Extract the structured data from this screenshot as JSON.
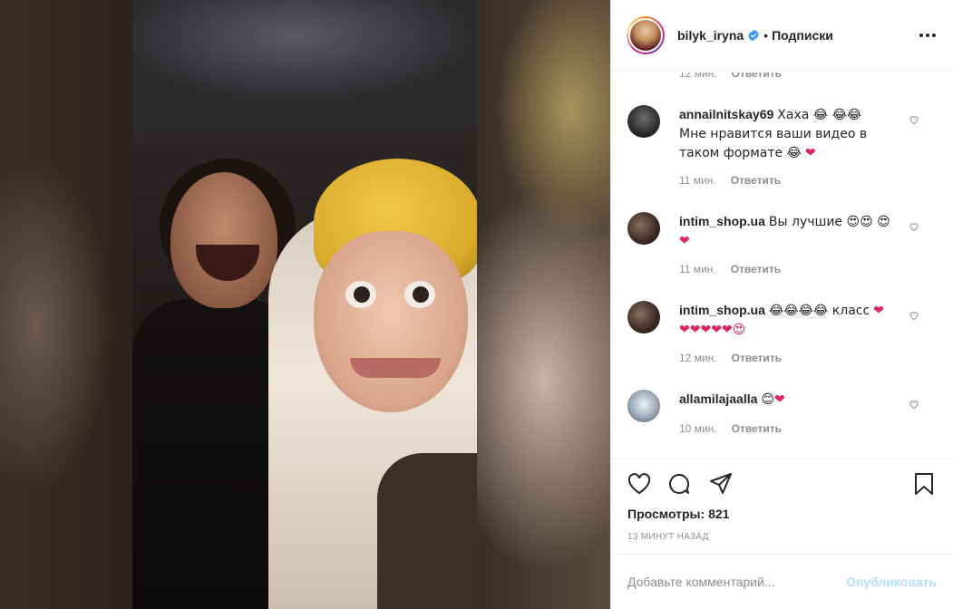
{
  "post": {
    "username": "bilyk_iryna",
    "separator": "•",
    "follow_label": "Подписки"
  },
  "comments_partial": {
    "time": "12 мин.",
    "reply": "Ответить"
  },
  "comments": [
    {
      "username": "annailnitskay69",
      "text": "Хаха 😂 😂😂 Мне нравится ваши видео в таком формате 😂",
      "trailing": "❤",
      "time": "11 мин.",
      "reply": "Ответить"
    },
    {
      "username": "intim_shop.ua",
      "text": "Вы лучшие 😍😍 😍",
      "trailing": "❤",
      "time": "11 мин.",
      "reply": "Ответить"
    },
    {
      "username": "intim_shop.ua",
      "text": "😂😂😂😂 класс",
      "trailing": "❤❤❤❤❤❤😍",
      "time": "12 мин.",
      "reply": "Ответить"
    },
    {
      "username": "allamilajaalla",
      "text": "😊",
      "trailing": "❤",
      "time": "10 мин.",
      "reply": "Ответить"
    }
  ],
  "stats": {
    "views_label": "Просмотры:",
    "views_count": "821",
    "posted_ago": "13 минут назад"
  },
  "composer": {
    "placeholder": "Добавьте комментарий...",
    "publish_label": "Опубликовать"
  },
  "colors": {
    "verified": "#3897f0",
    "heart": "#e0245e",
    "publish_disabled": "#b2dffc",
    "secondary_text": "#8e8e8e"
  },
  "icons": [
    "like-icon",
    "comment-icon",
    "share-icon",
    "save-icon",
    "more-icon",
    "verified-icon"
  ]
}
